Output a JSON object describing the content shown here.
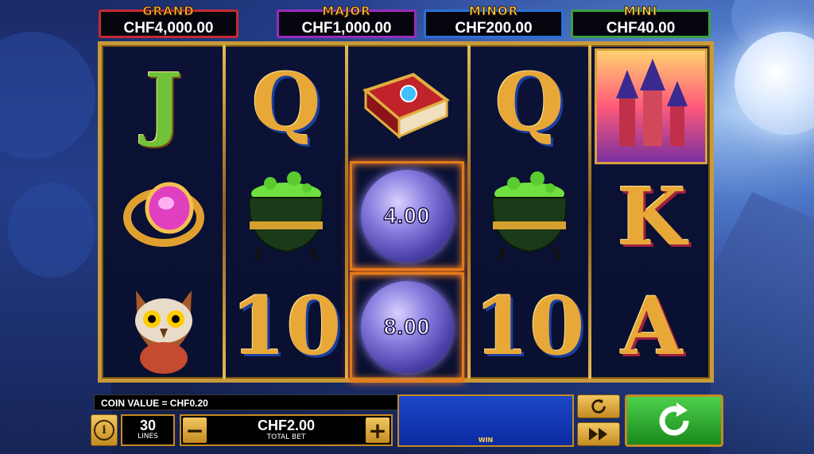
{
  "jackpots": [
    {
      "label": "GRAND",
      "value": "CHF4,000.00"
    },
    {
      "label": "MAJOR",
      "value": "CHF1,000.00"
    },
    {
      "label": "MINOR",
      "value": "CHF200.00"
    },
    {
      "label": "MINI",
      "value": "CHF40.00"
    }
  ],
  "reels": {
    "reel1": [
      "J",
      "ring",
      "owl"
    ],
    "reel2": [
      "Q",
      "cauldron",
      "10"
    ],
    "reel3": [
      "spellbook",
      "orb",
      "orb"
    ],
    "reel4": [
      "Q",
      "cauldron",
      "10"
    ],
    "reel5": [
      "castle",
      "K",
      "A"
    ]
  },
  "symbols": {
    "j": "J",
    "q": "Q",
    "ten": "10",
    "k": "K",
    "a": "A"
  },
  "orbs": [
    "4.00",
    "8.00"
  ],
  "controls": {
    "coin_value": "COIN VALUE = CHF0.20",
    "info_label": "i",
    "lines_value": "30",
    "lines_label": "LINES",
    "total_bet_value": "CHF2.00",
    "total_bet_label": "TOTAL BET",
    "minus_label": "−",
    "plus_label": "+",
    "win_label": "WIN",
    "autoplay_icon": "refresh-icon",
    "turbo_icon": "fast-forward-icon",
    "spin_icon": "spin-arrow-icon"
  },
  "colors": {
    "grand": "#c62a34",
    "major": "#9a2bbd",
    "minor": "#2a6fd8",
    "mini": "#3aa040",
    "gold": "#c79a3a",
    "spin": "#1a8a1a"
  }
}
